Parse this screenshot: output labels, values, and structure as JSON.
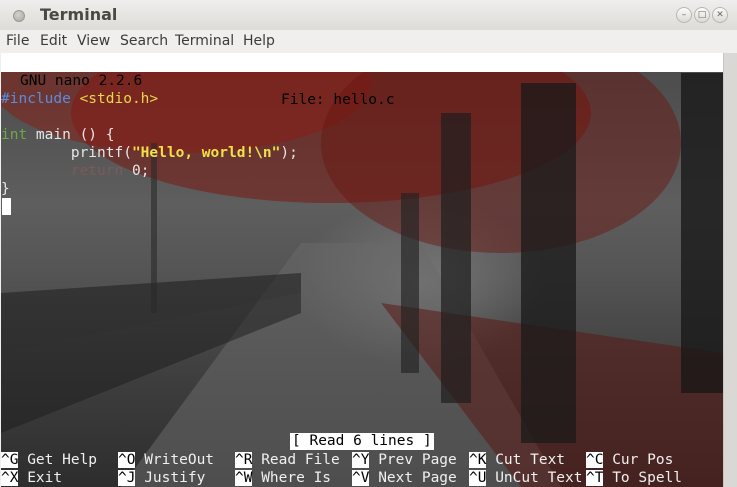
{
  "window": {
    "title": "Terminal"
  },
  "menu": [
    "File",
    "Edit",
    "View",
    "Search",
    "Terminal",
    "Help"
  ],
  "nano": {
    "version": "GNU nano 2.2.6",
    "file": "File: hello.c",
    "status": "[ Read 6 lines ]"
  },
  "code": {
    "line1_directive": "#include",
    "line1_header": "<stdio.h>",
    "line3_type": "int",
    "line3_rest": " main () {",
    "line4_indent": "        printf(",
    "line4_string": "\"Hello, world!\\n\"",
    "line4_end": ");",
    "line5_indent": "        ",
    "line5_return": "return",
    "line5_rest": " 0;",
    "line6": "}"
  },
  "shortcuts": [
    {
      "key": "^G",
      "label": "Get Help"
    },
    {
      "key": "^O",
      "label": "WriteOut"
    },
    {
      "key": "^R",
      "label": "Read File"
    },
    {
      "key": "^Y",
      "label": "Prev Page"
    },
    {
      "key": "^K",
      "label": "Cut Text"
    },
    {
      "key": "^C",
      "label": "Cur Pos"
    },
    {
      "key": "^X",
      "label": "Exit"
    },
    {
      "key": "^J",
      "label": "Justify"
    },
    {
      "key": "^W",
      "label": "Where Is"
    },
    {
      "key": "^V",
      "label": "Next Page"
    },
    {
      "key": "^U",
      "label": "UnCut Text"
    },
    {
      "key": "^T",
      "label": "To Spell"
    }
  ]
}
